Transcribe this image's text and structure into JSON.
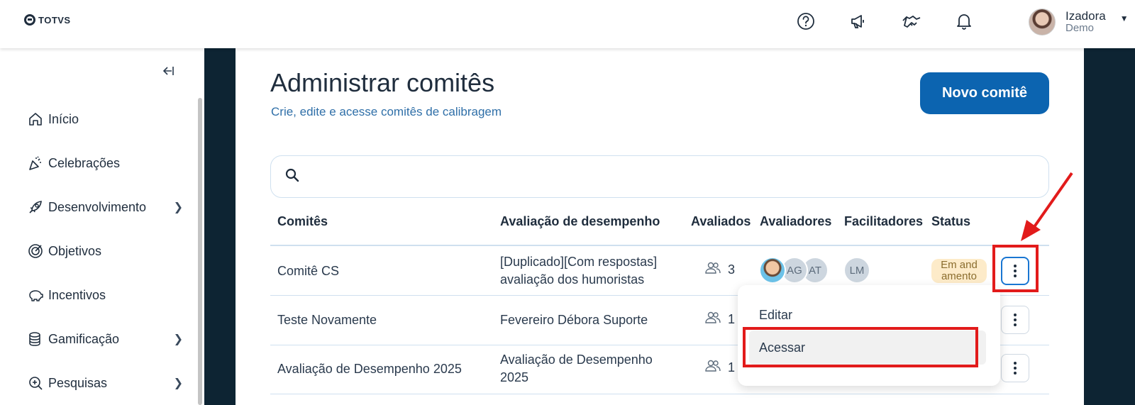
{
  "brand": {
    "logo_text": "TOTVS"
  },
  "topbar": {
    "icons": [
      "help-icon",
      "megaphone-icon",
      "handshake-icon",
      "bell-icon"
    ],
    "user": {
      "name": "Izadora",
      "role": "Demo"
    }
  },
  "sidebar": {
    "collapse_icon": "collapse-left-icon",
    "items": [
      {
        "label": "Início",
        "icon": "home-icon",
        "has_children": false
      },
      {
        "label": "Celebrações",
        "icon": "party-icon",
        "has_children": false
      },
      {
        "label": "Desenvolvimento",
        "icon": "rocket-icon",
        "has_children": true
      },
      {
        "label": "Objetivos",
        "icon": "target-icon",
        "has_children": false
      },
      {
        "label": "Incentivos",
        "icon": "piggy-bank-icon",
        "has_children": false
      },
      {
        "label": "Gamificação",
        "icon": "coins-icon",
        "has_children": true
      },
      {
        "label": "Pesquisas",
        "icon": "search-doc-icon",
        "has_children": true
      }
    ]
  },
  "main": {
    "title": "Administrar comitês",
    "subtitle": "Crie, edite e acesse comitês de calibragem",
    "new_button": "Novo comitê",
    "search": {
      "placeholder": "",
      "value": ""
    },
    "table": {
      "columns": [
        "Comitês",
        "Avaliação de desempenho",
        "Avaliados",
        "Avaliadores",
        "Facilitadores",
        "Status"
      ],
      "rows": [
        {
          "name": "Comitê CS",
          "evaluation": [
            "[Duplicado][Com respostas]",
            "avaliação dos humoristas"
          ],
          "evaluated": "3",
          "evaluators": [
            "photo",
            "AG",
            "AT"
          ],
          "facilitators": [
            "LM"
          ],
          "status": [
            "Em and",
            "amento"
          ]
        },
        {
          "name": "Teste Novamente",
          "evaluation": [
            "Fevereiro Débora Suporte"
          ],
          "evaluated": "1",
          "evaluators": [],
          "facilitators": [],
          "status": []
        },
        {
          "name": "Avaliação de Desempenho 2025",
          "evaluation": [
            "Avaliação de Desempenho",
            "2025"
          ],
          "evaluated": "1",
          "evaluators": [],
          "facilitators": [],
          "status": []
        }
      ]
    },
    "row_menu": {
      "items": [
        "Editar",
        "Acessar"
      ],
      "highlighted": "Acessar"
    }
  },
  "colors": {
    "primary": "#0c64b0",
    "sidebar_dark": "#0d2433",
    "annotation": "#e21b1b",
    "status_bg": "#fdebc9"
  }
}
